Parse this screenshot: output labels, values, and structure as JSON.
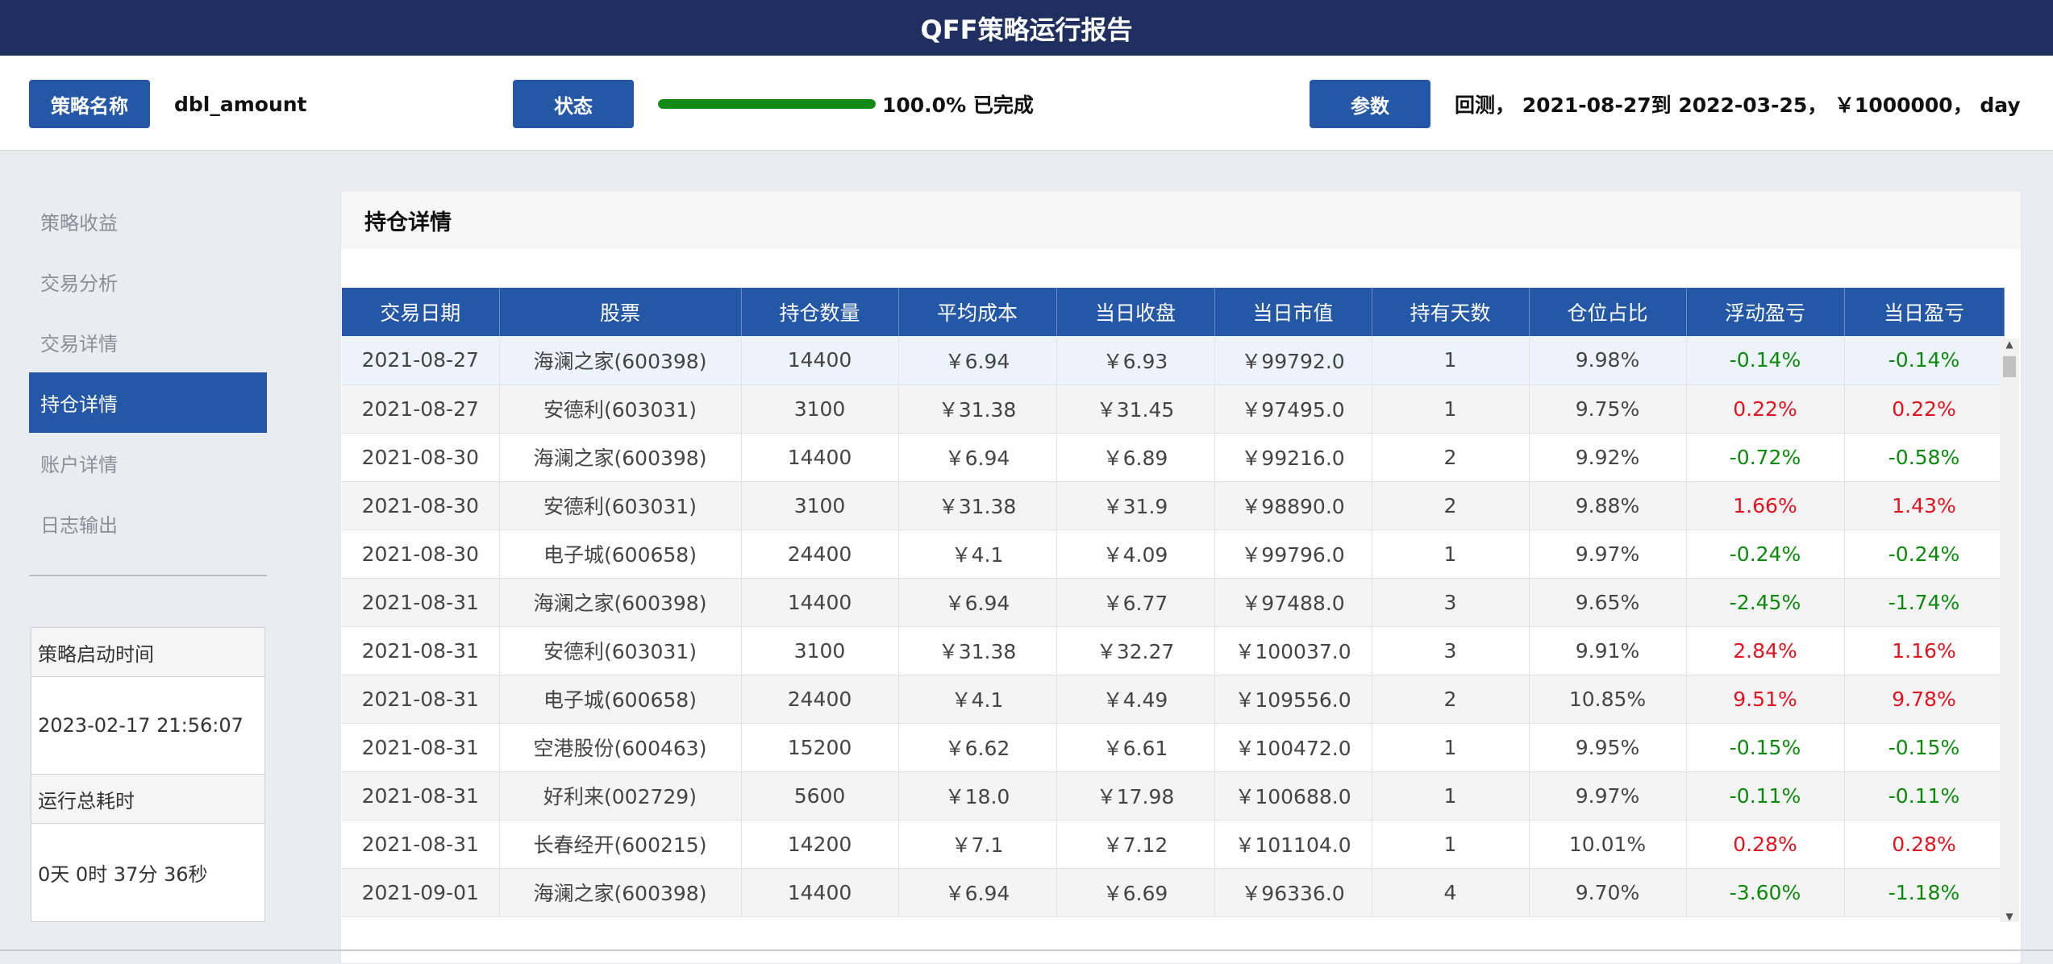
{
  "app": {
    "title": "QFF策略运行报告"
  },
  "info": {
    "strategy_label": "策略名称",
    "strategy_value": "dbl_amount",
    "status_label": "状态",
    "progress_fraction": 1.0,
    "status_value": "100.0% 已完成",
    "params_label": "参数",
    "params_value": "回测， 2021-08-27到 2022-03-25， ￥1000000， day"
  },
  "sidebar": {
    "items": [
      {
        "label": "策略收益"
      },
      {
        "label": "交易分析"
      },
      {
        "label": "交易详情"
      },
      {
        "label": "持仓详情"
      },
      {
        "label": "账户详情"
      },
      {
        "label": "日志输出"
      }
    ],
    "active_index": 3,
    "start_time_label": "策略启动时间",
    "start_time_value": "2023-02-17 21:56:07",
    "runtime_label": "运行总耗时",
    "runtime_value": "0天 0时 37分 36秒"
  },
  "panel": {
    "title": "持仓详情",
    "columns": [
      "交易日期",
      "股票",
      "持仓数量",
      "平均成本",
      "当日收盘",
      "当日市值",
      "持有天数",
      "仓位占比",
      "浮动盈亏",
      "当日盈亏"
    ],
    "rows": [
      [
        "2021-08-27",
        "海澜之家(600398)",
        "14400",
        "￥6.94",
        "￥6.93",
        "￥99792.0",
        "1",
        "9.98%",
        "-0.14%",
        "-0.14%"
      ],
      [
        "2021-08-27",
        "安德利(603031)",
        "3100",
        "￥31.38",
        "￥31.45",
        "￥97495.0",
        "1",
        "9.75%",
        "0.22%",
        "0.22%"
      ],
      [
        "2021-08-30",
        "海澜之家(600398)",
        "14400",
        "￥6.94",
        "￥6.89",
        "￥99216.0",
        "2",
        "9.92%",
        "-0.72%",
        "-0.58%"
      ],
      [
        "2021-08-30",
        "安德利(603031)",
        "3100",
        "￥31.38",
        "￥31.9",
        "￥98890.0",
        "2",
        "9.88%",
        "1.66%",
        "1.43%"
      ],
      [
        "2021-08-30",
        "电子城(600658)",
        "24400",
        "￥4.1",
        "￥4.09",
        "￥99796.0",
        "1",
        "9.97%",
        "-0.24%",
        "-0.24%"
      ],
      [
        "2021-08-31",
        "海澜之家(600398)",
        "14400",
        "￥6.94",
        "￥6.77",
        "￥97488.0",
        "3",
        "9.65%",
        "-2.45%",
        "-1.74%"
      ],
      [
        "2021-08-31",
        "安德利(603031)",
        "3100",
        "￥31.38",
        "￥32.27",
        "￥100037.0",
        "3",
        "9.91%",
        "2.84%",
        "1.16%"
      ],
      [
        "2021-08-31",
        "电子城(600658)",
        "24400",
        "￥4.1",
        "￥4.49",
        "￥109556.0",
        "2",
        "10.85%",
        "9.51%",
        "9.78%"
      ],
      [
        "2021-08-31",
        "空港股份(600463)",
        "15200",
        "￥6.62",
        "￥6.61",
        "￥100472.0",
        "1",
        "9.95%",
        "-0.15%",
        "-0.15%"
      ],
      [
        "2021-08-31",
        "好利来(002729)",
        "5600",
        "￥18.0",
        "￥17.98",
        "￥100688.0",
        "1",
        "9.97%",
        "-0.11%",
        "-0.11%"
      ],
      [
        "2021-08-31",
        "长春经开(600215)",
        "14200",
        "￥7.1",
        "￥7.12",
        "￥101104.0",
        "1",
        "10.01%",
        "0.28%",
        "0.28%"
      ],
      [
        "2021-09-01",
        "海澜之家(600398)",
        "14400",
        "￥6.94",
        "￥6.69",
        "￥96336.0",
        "4",
        "9.70%",
        "-3.60%",
        "-1.18%"
      ]
    ]
  },
  "colors": {
    "header": "#1f3060",
    "accent": "#2458a6",
    "positive": "#e0141e",
    "negative": "#0a8a0a",
    "progress": "#138a13"
  },
  "icons": {
    "scroll_up": "scroll-up-arrow-icon",
    "scroll_down": "scroll-down-arrow-icon"
  }
}
